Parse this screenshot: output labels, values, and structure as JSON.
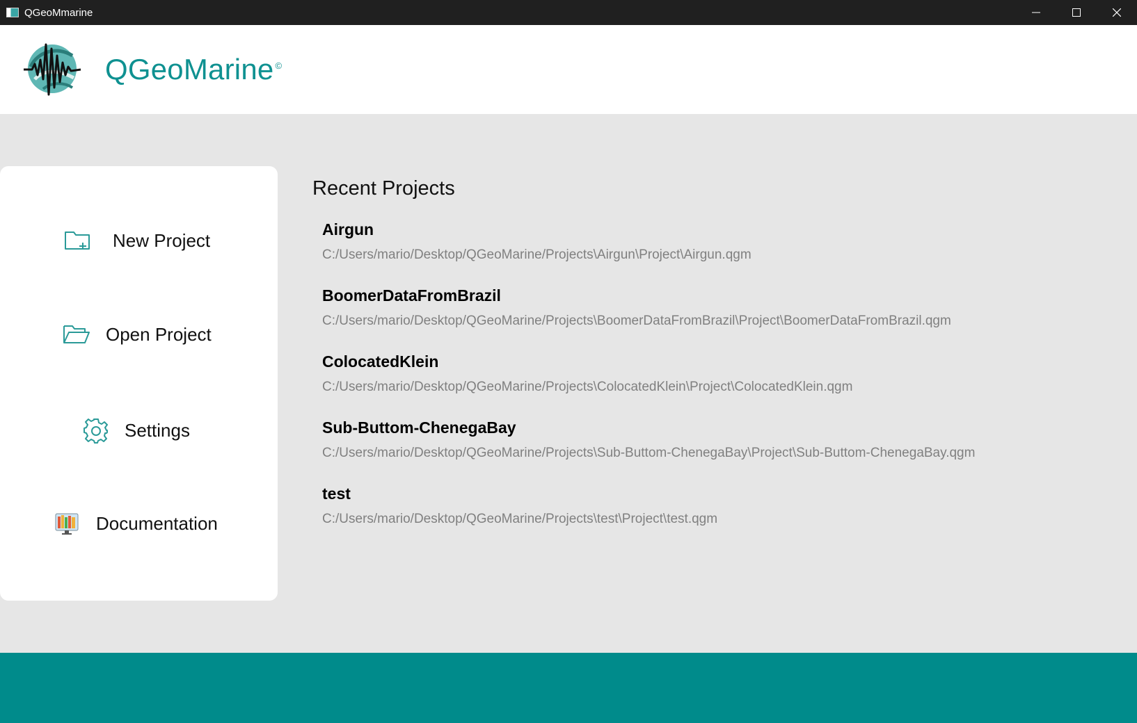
{
  "window": {
    "title": "QGeoMmarine",
    "controls": {
      "minimize_icon": "minimize-icon",
      "maximize_icon": "maximize-icon",
      "close_icon": "close-icon"
    }
  },
  "header": {
    "brand": "QGeoMarine",
    "copyright": "©",
    "logo_icon": "seismic-wave-logo-icon"
  },
  "sidebar": {
    "items": [
      {
        "label": "New Project",
        "icon": "folder-plus-icon"
      },
      {
        "label": "Open Project",
        "icon": "folder-open-icon"
      },
      {
        "label": "Settings",
        "icon": "gear-icon"
      },
      {
        "label": "Documentation",
        "icon": "book-shelf-icon"
      }
    ]
  },
  "recent": {
    "title": "Recent Projects",
    "projects": [
      {
        "name": "Airgun",
        "path": "C:/Users/mario/Desktop/QGeoMarine/Projects\\Airgun\\Project\\Airgun.qgm"
      },
      {
        "name": "BoomerDataFromBrazil",
        "path": "C:/Users/mario/Desktop/QGeoMarine/Projects\\BoomerDataFromBrazil\\Project\\BoomerDataFromBrazil.qgm"
      },
      {
        "name": "ColocatedKlein",
        "path": "C:/Users/mario/Desktop/QGeoMarine/Projects\\ColocatedKlein\\Project\\ColocatedKlein.qgm"
      },
      {
        "name": "Sub-Buttom-ChenegaBay",
        "path": "C:/Users/mario/Desktop/QGeoMarine/Projects\\Sub-Buttom-ChenegaBay\\Project\\Sub-Buttom-ChenegaBay.qgm"
      },
      {
        "name": "test",
        "path": "C:/Users/mario/Desktop/QGeoMarine/Projects\\test\\Project\\test.qgm"
      }
    ]
  },
  "colors": {
    "accent": "#008b8b",
    "brand_text": "#0f9191",
    "background": "#e6e6e6",
    "titlebar": "#202020"
  }
}
